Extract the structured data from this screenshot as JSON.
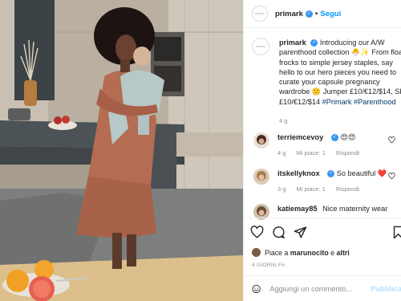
{
  "post": {
    "username": "primark",
    "follow_label": "Segui",
    "dot": "•",
    "avatar_text": "primark"
  },
  "caption": {
    "username": "primark",
    "lines": [
      "Introducing our A/W",
      "parenthood collection 🐣✨ From floaty",
      "frocks to simple jersey staples, say",
      "hello to our hero pieces you need to",
      "curate your capsule pregnancy",
      "wardrobe 🙂 Jumper £10/€12/$14, Skirt",
      "£10/€12/$14"
    ],
    "hashtags": [
      "#Primark",
      "#Parenthood"
    ],
    "time": "4 g"
  },
  "comments": [
    {
      "username": "terriemcevoy",
      "text": "😍😍",
      "time": "4 g",
      "likes": "Mi piace: 1",
      "reply": "Rispondi"
    },
    {
      "username": "itskellyknox",
      "text": "So beautiful ❤️",
      "time": "3 g",
      "likes": "Mi piace: 1",
      "reply": "Rispondi"
    },
    {
      "username": "katiemay85",
      "text": "Nice maternity wear"
    }
  ],
  "likes_line": {
    "prefix": "Piace a",
    "user": "marunocito",
    "connector": "e",
    "others": "altri"
  },
  "date": "4 GIORNI FA",
  "add_comment": {
    "placeholder": "Aggiungi un commento...",
    "publish_label": "Pubblica"
  },
  "colors": {
    "link_blue": "#0095f6",
    "verified": "#3897f0",
    "heart_red": "#ed4956",
    "muted": "#8e8e8e",
    "publish_disabled": "#b2dffc"
  },
  "icons": [
    "heart-icon",
    "comment-icon",
    "share-icon",
    "bookmark-icon",
    "emoji-icon",
    "verified-icon"
  ]
}
